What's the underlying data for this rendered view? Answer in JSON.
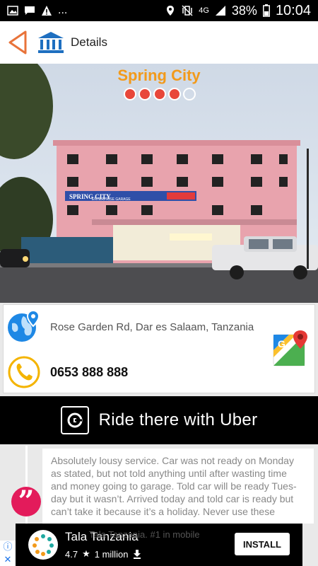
{
  "status_bar": {
    "battery": "38%",
    "time": "10:04",
    "network": "4G",
    "more": "..."
  },
  "toolbar": {
    "title": "Details"
  },
  "place": {
    "name": "Spring City",
    "rating": 4,
    "rating_max": 5,
    "sign_text": "SPRING CITY",
    "sign_sub": "ENTERPRISE GARAGE",
    "address": "Rose Garden Rd, Dar es Salaam, Tanzania",
    "phone": "0653 888 888"
  },
  "uber": {
    "label": "Ride there with Uber"
  },
  "review": {
    "text": "Absolutely lousy service. Car was not ready on Monday as stated, but not told anything until after wasting time and money going to garage. Told car will be ready Tues-day but it wasn’t. Arrived today and told car is ready but can’t take it because it’s a holiday. Never use these"
  },
  "ad": {
    "app_name": "Tala Tanzania",
    "rating": "4.7",
    "installs": "1 million",
    "faded_text": "Tala Tanzania. #1 in mobile",
    "install_label": "INSTALL",
    "info_icon": "info-icon",
    "close_icon": "close-icon",
    "close_label": "✕",
    "info_label": "ⓘ"
  },
  "colors": {
    "accent_orange": "#f29a1b",
    "rating_red": "#e8473a",
    "quote_pink": "#e31b5b",
    "icon_blue": "#1e88e5",
    "phone_yellow": "#f4b400"
  }
}
